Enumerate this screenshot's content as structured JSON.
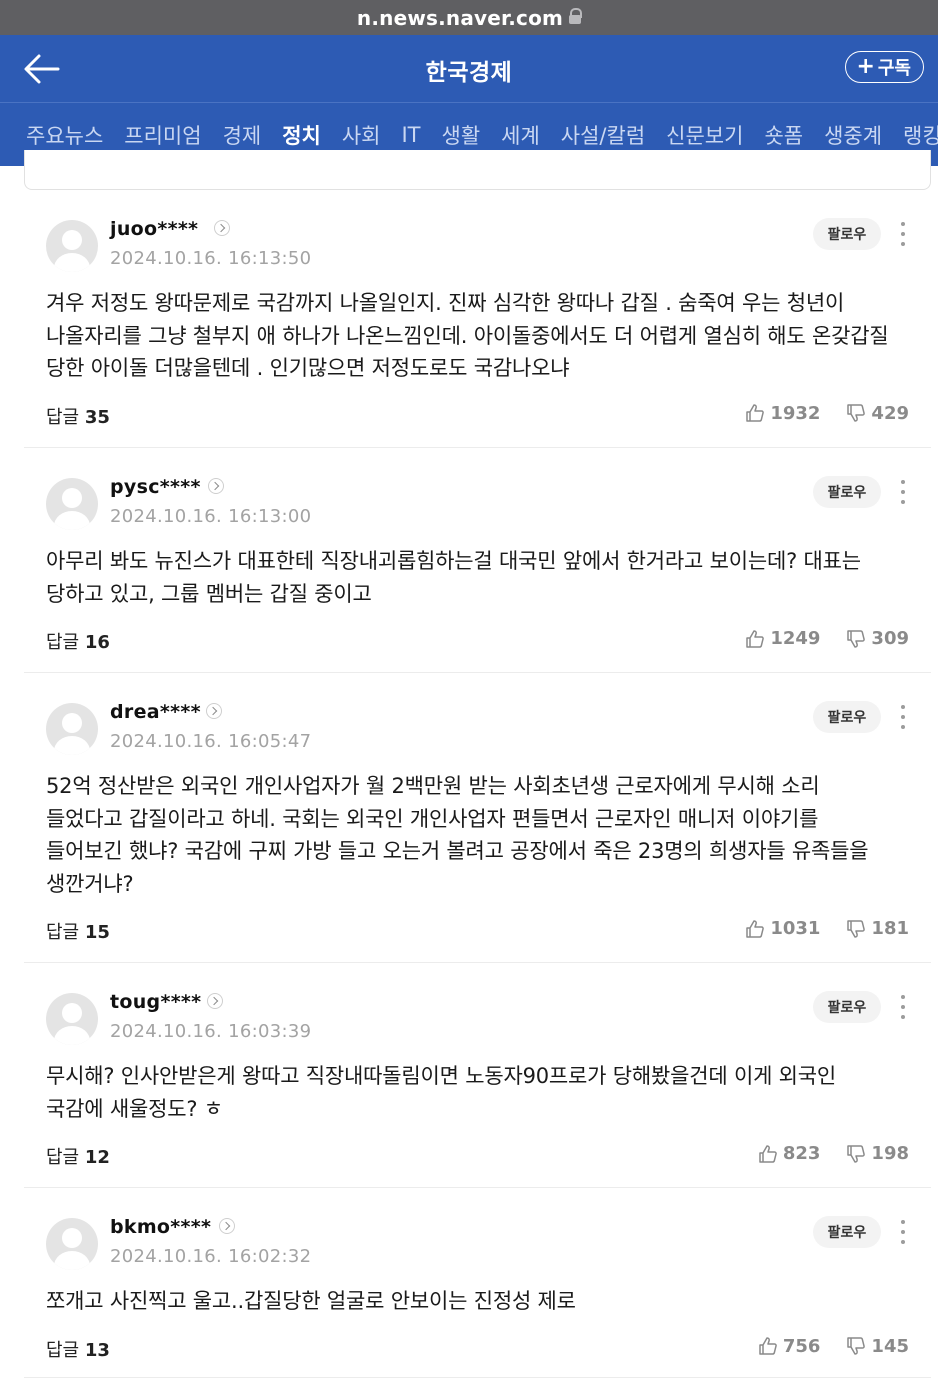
{
  "browser": {
    "url": "n.news.naver.com"
  },
  "header": {
    "title": "한국경제",
    "subscribe_label": "구독",
    "subscribe_plus": "+"
  },
  "nav": {
    "items": [
      "주요뉴스",
      "프리미엄",
      "경제",
      "정치",
      "사회",
      "IT",
      "생활",
      "세계",
      "사설/칼럼",
      "신문보기",
      "숏폼",
      "생중계",
      "랭킹"
    ],
    "active": "정치"
  },
  "comments": [
    {
      "user": "juoo****",
      "time": "2024.10.16. 16:13:50",
      "text": "겨우 저정도 왕따문제로 국감까지 나올일인지. 진짜 심각한 왕따나 갑질 . 숨죽여 우는 청년이 나올자리를 그냥 철부지 애 하나가 나온느낌인데. 아이돌중에서도 더 어렵게 열심히 해도 온갖갑질 당한 아이돌 더많을텐데 . 인기많으면 저정도로도 국감나오냐",
      "reply_label": "답글",
      "replies": "35",
      "likes": "1932",
      "dislikes": "429",
      "follow": "팔로우"
    },
    {
      "user": "pysc****",
      "time": "2024.10.16. 16:13:00",
      "text": "아무리 봐도 뉴진스가 대표한테 직장내괴롭힘하는걸 대국민 앞에서 한거라고 보이는데? 대표는 당하고 있고, 그룹 멤버는 갑질 중이고",
      "reply_label": "답글",
      "replies": "16",
      "likes": "1249",
      "dislikes": "309",
      "follow": "팔로우"
    },
    {
      "user": "drea****",
      "time": "2024.10.16. 16:05:47",
      "text": "52억 정산받은 외국인 개인사업자가 월 2백만원 받는 사회초년생 근로자에게 무시해 소리 들었다고 갑질이라고 하네. 국회는 외국인 개인사업자 편들면서 근로자인 매니저 이야기를 들어보긴 했냐? 국감에 구찌 가방 들고 오는거 볼려고 공장에서 죽은 23명의 희생자들 유족들을 생깐거냐?",
      "reply_label": "답글",
      "replies": "15",
      "likes": "1031",
      "dislikes": "181",
      "follow": "팔로우"
    },
    {
      "user": "toug****",
      "time": "2024.10.16. 16:03:39",
      "text": "무시해? 인사안받은게 왕따고 직장내따돌림이면 노동자90프로가 당해봤을건데 이게 외국인 국감에 새울정도? ㅎ",
      "reply_label": "답글",
      "replies": "12",
      "likes": "823",
      "dislikes": "198",
      "follow": "팔로우"
    },
    {
      "user": "bkmo****",
      "time": "2024.10.16. 16:02:32",
      "text": "쪼개고 사진찍고 울고..갑질당한 얼굴로 안보이는 진정성 제로",
      "reply_label": "답글",
      "replies": "13",
      "likes": "756",
      "dislikes": "145",
      "follow": "팔로우"
    }
  ]
}
